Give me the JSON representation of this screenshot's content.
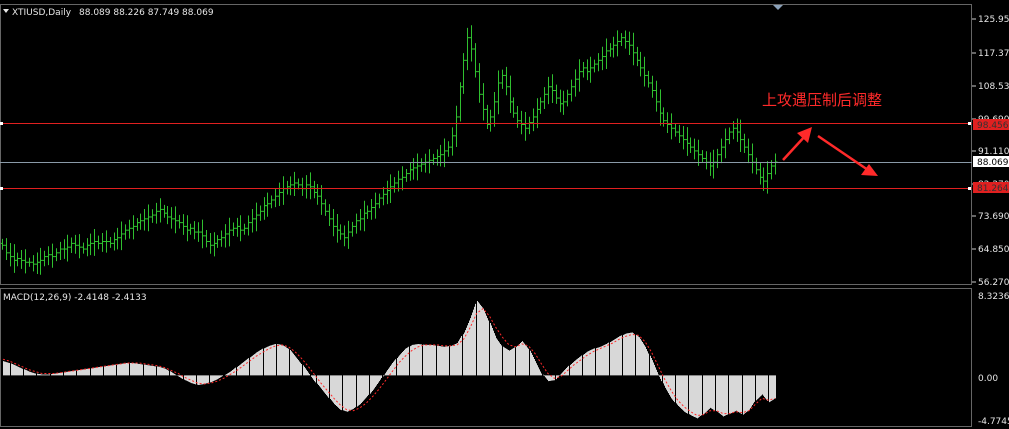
{
  "header": {
    "symbol": "XTIUSD,Daily",
    "ohlc": "88.089 88.226 87.749 88.069"
  },
  "colors": {
    "background": "#000000",
    "candle": "#2fbf2f",
    "hline": "#e02020",
    "current_line": "#8a9aa8",
    "macd_hist": "#d8d8d8",
    "macd_signal": "#ff2a2a",
    "annotation": "#ff2a2a"
  },
  "annotation": {
    "text": "上攻遇压制后调整"
  },
  "price_axis": {
    "ticks": [
      "125.950",
      "117.370",
      "108.530",
      "99.690",
      "91.110",
      "82.270",
      "73.690",
      "64.850",
      "56.270"
    ],
    "levels": [
      {
        "name": "resistance",
        "value": "98.456"
      },
      {
        "name": "current",
        "value": "88.069"
      },
      {
        "name": "support",
        "value": "81.264"
      }
    ]
  },
  "macd_panel": {
    "label": "MACD(12,26,9) -2.4148 -2.4133",
    "ticks": [
      "8.3236",
      "0.00",
      "-4.7745"
    ]
  },
  "chart_data": [
    {
      "type": "candlestick",
      "title": "XTIUSD,Daily",
      "ylim": [
        56.27,
        125.95
      ],
      "closes": [
        66.0,
        64.0,
        63.0,
        62.0,
        62.5,
        62.0,
        61.5,
        61.5,
        61.0,
        61.5,
        62.0,
        63.0,
        63.5,
        63.0,
        64.0,
        65.0,
        65.0,
        65.5,
        66.5,
        66.0,
        65.5,
        65.0,
        66.0,
        66.5,
        67.0,
        66.5,
        67.0,
        67.0,
        66.5,
        67.5,
        68.0,
        69.0,
        70.0,
        70.5,
        71.0,
        72.0,
        72.5,
        73.0,
        73.5,
        74.0,
        75.0,
        75.5,
        74.5,
        73.5,
        73.0,
        72.5,
        72.0,
        71.0,
        70.0,
        70.5,
        69.5,
        69.5,
        68.5,
        67.0,
        66.0,
        66.5,
        67.5,
        68.0,
        69.0,
        70.0,
        70.5,
        71.0,
        70.0,
        70.5,
        72.0,
        73.0,
        74.0,
        75.0,
        76.5,
        77.0,
        78.0,
        79.0,
        80.0,
        81.0,
        81.5,
        82.0,
        82.5,
        82.0,
        81.0,
        82.0,
        81.5,
        80.0,
        79.0,
        77.0,
        75.0,
        73.0,
        71.0,
        70.0,
        69.0,
        68.0,
        69.5,
        71.0,
        72.5,
        73.0,
        74.5,
        75.0,
        76.0,
        77.0,
        78.5,
        79.5,
        80.5,
        81.5,
        82.5,
        83.5,
        84.0,
        85.0,
        86.0,
        86.5,
        87.0,
        87.5,
        88.0,
        88.5,
        89.0,
        89.5,
        90.0,
        91.0,
        92.0,
        95.0,
        100.0,
        108.0,
        115.0,
        121.0,
        118.0,
        112.0,
        106.0,
        102.0,
        98.0,
        100.0,
        104.0,
        109.0,
        111.0,
        108.0,
        104.0,
        101.0,
        99.0,
        98.0,
        97.0,
        98.5,
        100.0,
        102.0,
        104.0,
        106.0,
        108.0,
        107.0,
        105.0,
        103.5,
        104.0,
        106.0,
        108.0,
        110.0,
        112.0,
        113.0,
        112.0,
        113.0,
        114.0,
        115.0,
        116.0,
        117.5,
        118.0,
        119.0,
        120.0,
        121.0,
        120.0,
        119.0,
        117.0,
        115.0,
        113.0,
        111.0,
        109.0,
        107.0,
        104.0,
        101.0,
        99.0,
        98.0,
        97.0,
        96.0,
        95.0,
        94.0,
        93.0,
        92.0,
        91.0,
        90.0,
        89.0,
        88.0,
        87.0,
        88.0,
        90.0,
        92.0,
        94.0,
        96.0,
        97.0,
        96.0,
        94.0,
        92.0,
        90.0,
        88.0,
        86.0,
        84.0,
        83.0,
        85.0,
        87.0,
        88.069
      ],
      "levels": [
        98.456,
        88.069,
        81.264
      ],
      "annotation": "上攻遇压制后调整"
    },
    {
      "type": "bar",
      "title": "MACD(12,26,9) -2.4148 -2.4133",
      "ylim": [
        -4.7745,
        8.3236
      ],
      "histogram": [
        1.5,
        1.3,
        1.0,
        0.7,
        0.4,
        0.2,
        0.1,
        0.1,
        0.2,
        0.3,
        0.4,
        0.5,
        0.6,
        0.7,
        0.8,
        0.9,
        1.0,
        1.1,
        1.2,
        1.3,
        1.3,
        1.2,
        1.1,
        1.0,
        0.9,
        0.7,
        0.3,
        -0.1,
        -0.5,
        -0.8,
        -1.0,
        -0.9,
        -0.7,
        -0.4,
        0.0,
        0.4,
        0.9,
        1.4,
        1.9,
        2.4,
        2.8,
        3.1,
        3.3,
        3.2,
        2.8,
        2.0,
        1.2,
        0.3,
        -0.6,
        -1.4,
        -2.2,
        -3.0,
        -3.6,
        -3.8,
        -3.5,
        -3.0,
        -2.3,
        -1.5,
        -0.6,
        0.4,
        1.3,
        2.1,
        2.8,
        3.2,
        3.3,
        3.2,
        3.2,
        3.1,
        3.0,
        3.1,
        3.4,
        4.5,
        6.0,
        7.8,
        7.0,
        5.5,
        3.9,
        3.0,
        2.6,
        3.0,
        3.6,
        2.8,
        1.5,
        0.2,
        -0.6,
        -0.5,
        0.2,
        0.9,
        1.5,
        2.0,
        2.5,
        2.8,
        3.0,
        3.3,
        3.7,
        4.1,
        4.4,
        4.5,
        4.0,
        3.0,
        1.6,
        0.1,
        -1.3,
        -2.4,
        -3.2,
        -3.8,
        -4.2,
        -4.5,
        -4.0,
        -3.4,
        -3.8,
        -4.3,
        -4.0,
        -3.7,
        -4.1,
        -3.6,
        -2.6,
        -2.0,
        -2.8,
        -2.4
      ],
      "signal": [
        1.7,
        1.5,
        1.2,
        0.9,
        0.6,
        0.4,
        0.2,
        0.2,
        0.2,
        0.3,
        0.4,
        0.5,
        0.6,
        0.7,
        0.8,
        0.9,
        1.0,
        1.1,
        1.2,
        1.3,
        1.3,
        1.3,
        1.2,
        1.1,
        1.0,
        0.8,
        0.5,
        0.2,
        -0.2,
        -0.5,
        -0.8,
        -0.9,
        -0.8,
        -0.6,
        -0.3,
        0.1,
        0.5,
        1.0,
        1.5,
        2.0,
        2.4,
        2.8,
        3.1,
        3.2,
        3.0,
        2.5,
        1.8,
        1.0,
        0.1,
        -0.8,
        -1.6,
        -2.4,
        -3.1,
        -3.6,
        -3.7,
        -3.4,
        -2.9,
        -2.2,
        -1.4,
        -0.5,
        0.4,
        1.3,
        2.0,
        2.6,
        3.0,
        3.2,
        3.2,
        3.2,
        3.1,
        3.1,
        3.2,
        3.8,
        5.0,
        6.5,
        7.0,
        6.2,
        5.0,
        4.0,
        3.2,
        3.0,
        3.3,
        3.1,
        2.3,
        1.2,
        0.2,
        -0.3,
        -0.1,
        0.5,
        1.1,
        1.6,
        2.1,
        2.5,
        2.8,
        3.1,
        3.4,
        3.8,
        4.1,
        4.3,
        4.2,
        3.5,
        2.4,
        1.0,
        -0.4,
        -1.6,
        -2.6,
        -3.3,
        -3.8,
        -4.2,
        -4.1,
        -3.7,
        -3.7,
        -4.0,
        -4.0,
        -3.8,
        -3.9,
        -3.7,
        -3.0,
        -2.4,
        -2.6,
        -2.4
      ]
    }
  ]
}
